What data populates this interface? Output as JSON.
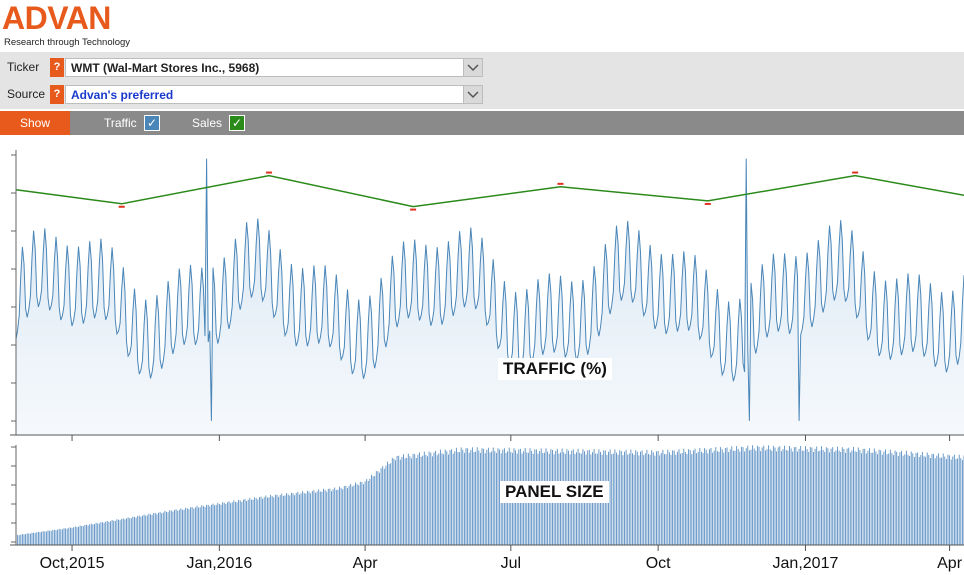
{
  "brand": {
    "name": "ADVAN",
    "tagline": "Research through Technology",
    "color": "#e85a1b"
  },
  "controls": {
    "ticker": {
      "label": "Ticker",
      "help": "?",
      "value": "WMT (Wal-Mart Stores Inc., 5968)"
    },
    "source": {
      "label": "Source",
      "help": "?",
      "value": "Advan's preferred"
    }
  },
  "showbar": {
    "show_label": "Show",
    "traffic_label": "Traffic",
    "traffic_checked": true,
    "traffic_check": "✓",
    "sales_label": "Sales",
    "sales_checked": true,
    "sales_check": "✓"
  },
  "colors": {
    "accent": "#e85a1b",
    "traffic": "#4a86b8",
    "sales": "#2a8a1a",
    "sales_marker": "#e03020",
    "panel": "#5b90c4"
  },
  "icons": [
    "help-icon",
    "chevron-down-icon",
    "checkbox-icon"
  ],
  "chart_data": [
    {
      "type": "line",
      "title": "TRAFFIC (%)",
      "series": [
        {
          "name": "Traffic",
          "start": "2015-08-27",
          "end": "2017-04-10",
          "baseline": "weekly oscillation",
          "spikes": [
            [
              "2015-12-24",
              "high"
            ],
            [
              "2015-12-27",
              "low"
            ],
            [
              "2016-11-25",
              "high"
            ],
            [
              "2016-11-27",
              "low"
            ],
            [
              "2016-12-28",
              "low"
            ]
          ]
        },
        {
          "name": "Sales",
          "type": "line",
          "x": [
            "2015-08-27",
            "2015-11-01",
            "2016-02-01",
            "2016-05-01",
            "2016-08-01",
            "2016-11-01",
            "2017-02-01",
            "2017-04-10"
          ],
          "y": [
            0.87,
            0.82,
            0.92,
            0.81,
            0.88,
            0.83,
            0.92,
            0.85
          ]
        }
      ]
    },
    {
      "type": "bar",
      "title": "PANEL SIZE",
      "x": [
        "2015-08-27",
        "2015-10-01",
        "2015-12-01",
        "2016-02-01",
        "2016-03-15",
        "2016-04-01",
        "2016-04-20",
        "2016-06-01",
        "2016-10-01",
        "2016-12-01",
        "2017-02-01",
        "2017-04-10"
      ],
      "y": [
        0.1,
        0.18,
        0.35,
        0.5,
        0.58,
        0.65,
        0.9,
        0.98,
        0.95,
        1.0,
        0.98,
        0.9
      ]
    }
  ],
  "axis": {
    "x_labels": [
      {
        "text": "Oct,2015",
        "date": "2015-10-01"
      },
      {
        "text": "Jan,2016",
        "date": "2016-01-01"
      },
      {
        "text": "Apr",
        "date": "2016-04-01"
      },
      {
        "text": "Jul",
        "date": "2016-07-01"
      },
      {
        "text": "Oct",
        "date": "2016-10-01"
      },
      {
        "text": "Jan,2017",
        "date": "2017-01-01"
      },
      {
        "text": "Apr",
        "date": "2017-04-01"
      }
    ]
  }
}
